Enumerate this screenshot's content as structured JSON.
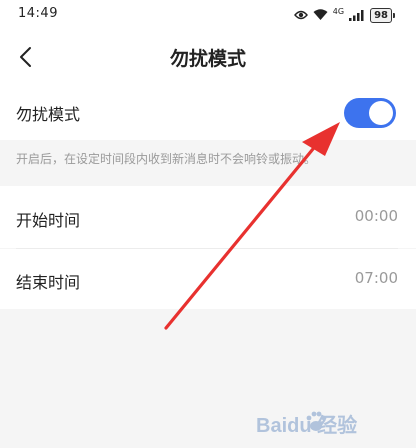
{
  "status_bar": {
    "time": "14:49",
    "network_label": "4G",
    "battery": "98",
    "icons": [
      "eye-icon",
      "wifi-icon",
      "signal-icon",
      "battery-icon"
    ]
  },
  "navbar": {
    "title": "勿扰模式",
    "back_icon": "chevron-left-icon"
  },
  "dnd": {
    "label": "勿扰模式",
    "enabled": true,
    "hint": "开启后，在设定时间段内收到新消息时不会响铃或振动。"
  },
  "schedule": {
    "start_label": "开始时间",
    "start_value": "00:00",
    "end_label": "结束时间",
    "end_value": "07:00"
  },
  "colors": {
    "accent": "#3d73ee",
    "annotation_arrow": "#e8312f",
    "background": "#f5f5f5"
  },
  "watermark": {
    "icon": "baidu-paw-logo",
    "text": "Baidu 经验"
  }
}
